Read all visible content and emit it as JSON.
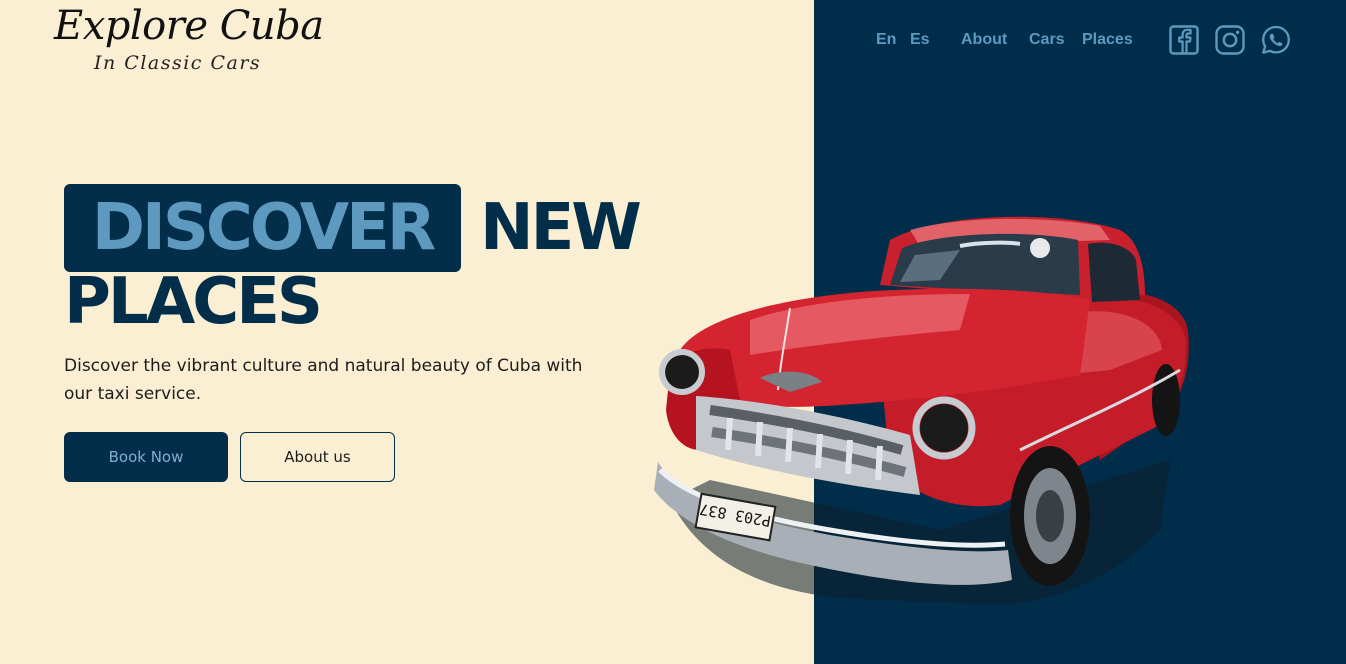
{
  "brand": {
    "title": "Explore Cuba",
    "subtitle": "In Classic Cars"
  },
  "nav": {
    "languages": [
      "En",
      "Es"
    ],
    "links": [
      "About",
      "Cars",
      "Places"
    ],
    "social_icons": [
      "facebook-icon",
      "instagram-icon",
      "whatsapp-icon"
    ]
  },
  "hero": {
    "headline_highlight": "DISCOVER",
    "headline_rest_line1": "NEW",
    "headline_line2": "PLACES",
    "description": "Discover the vibrant culture and natural beauty of Cuba with our taxi service.",
    "primary_button": "Book Now",
    "secondary_button": "About us"
  },
  "car": {
    "license_plate": "P203 837"
  },
  "colors": {
    "cream_background": "#fbefd3",
    "navy": "#022e4a",
    "accent_blue": "#5e9ac0",
    "car_red": "#d8252f"
  }
}
